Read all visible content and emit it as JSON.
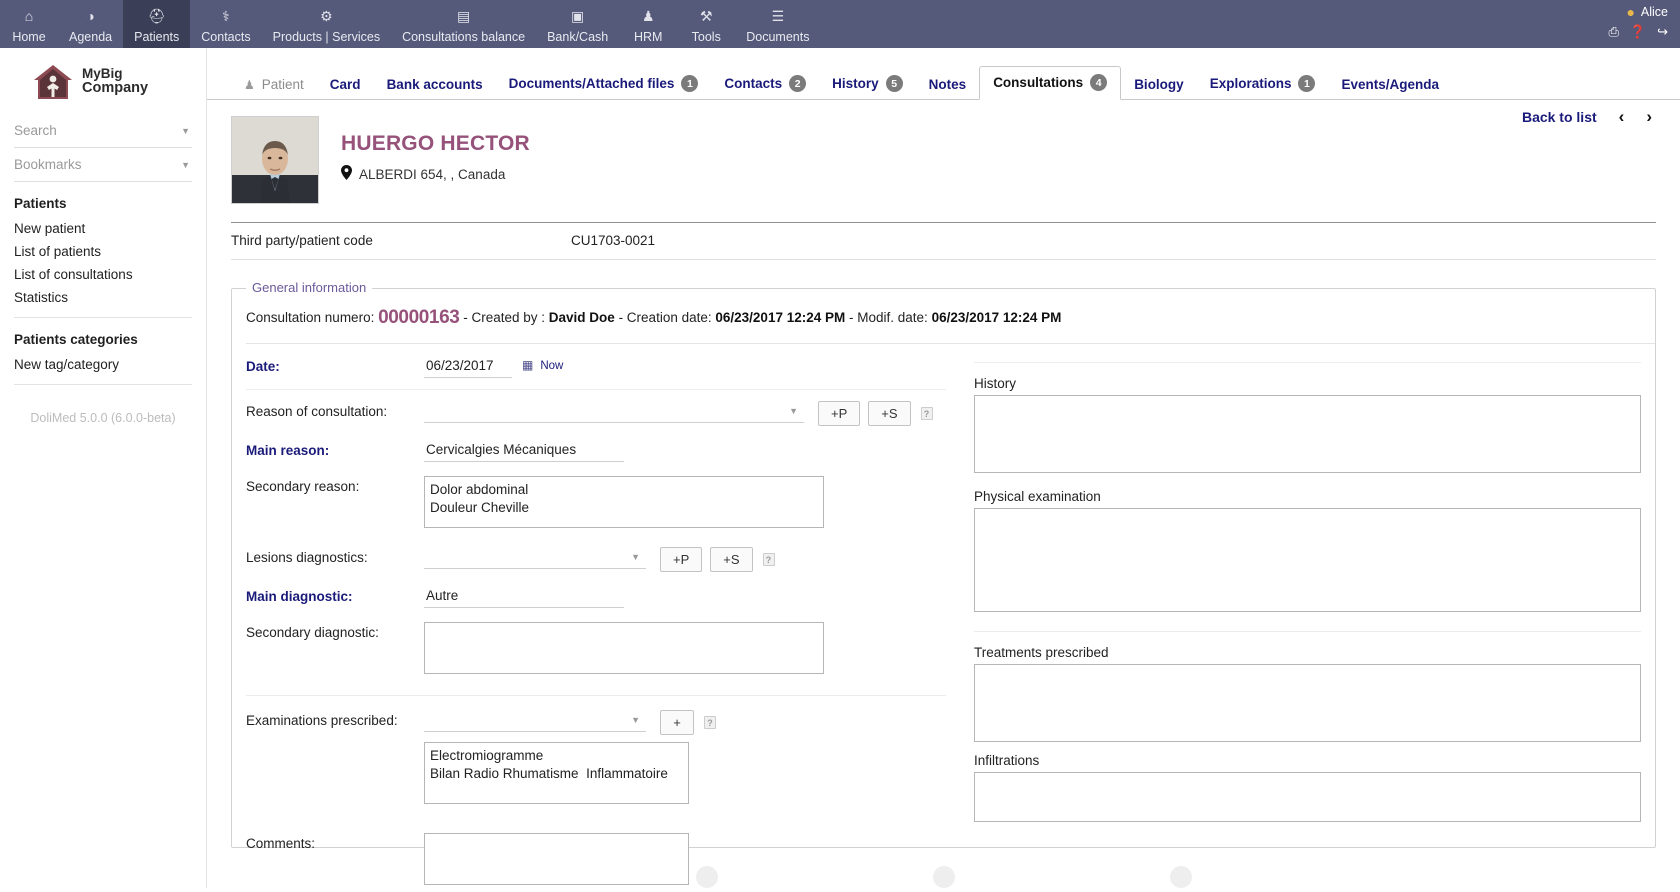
{
  "topnav": {
    "items": [
      {
        "label": "Home",
        "icon": "home-icon",
        "glyph": "⌂",
        "active": false
      },
      {
        "label": "Agenda",
        "icon": "agenda-icon",
        "glyph": "◑",
        "active": false
      },
      {
        "label": "Patients",
        "icon": "patients-icon",
        "glyph": "⛑",
        "active": true
      },
      {
        "label": "Contacts",
        "icon": "stethoscope-icon",
        "glyph": "⚕",
        "active": false
      },
      {
        "label": "Products | Services",
        "icon": "products-icon",
        "glyph": "⚙",
        "active": false
      },
      {
        "label": "Consultations balance",
        "icon": "balance-icon",
        "glyph": "▤",
        "active": false
      },
      {
        "label": "Bank/Cash",
        "icon": "bank-icon",
        "glyph": "▣",
        "active": false
      },
      {
        "label": "HRM",
        "icon": "hrm-icon",
        "glyph": "♟",
        "active": false
      },
      {
        "label": "Tools",
        "icon": "tools-icon",
        "glyph": "⚒",
        "active": false
      },
      {
        "label": "Documents",
        "icon": "documents-icon",
        "glyph": "☰",
        "active": false
      }
    ],
    "user": "Alice",
    "user_icon": "user-avatar-icon",
    "actions": [
      {
        "name": "print-icon",
        "glyph": "⎙"
      },
      {
        "name": "help-icon",
        "glyph": "❓"
      },
      {
        "name": "logout-icon",
        "glyph": "↪"
      }
    ]
  },
  "sidebar": {
    "logo_line1": "MyBig",
    "logo_line2": "Company",
    "logo_icon": "company-house-logo",
    "search_placeholder": "Search",
    "bookmarks_placeholder": "Bookmarks",
    "groups": [
      {
        "title": "Patients",
        "links": [
          "New patient",
          "List of patients",
          "List of consultations",
          "Statistics"
        ]
      },
      {
        "title": "Patients categories",
        "links": [
          "New tag/category"
        ]
      }
    ],
    "version": "DoliMed 5.0.0 (6.0.0-beta)"
  },
  "tabs": [
    {
      "label": "Patient",
      "badge": "",
      "icon": "patient-icon",
      "state": "plain"
    },
    {
      "label": "Card",
      "badge": "",
      "icon": "",
      "state": "normal"
    },
    {
      "label": "Bank accounts",
      "badge": "",
      "icon": "",
      "state": "normal"
    },
    {
      "label": "Documents/Attached files",
      "badge": "1",
      "icon": "",
      "state": "normal"
    },
    {
      "label": "Contacts",
      "badge": "2",
      "icon": "",
      "state": "normal"
    },
    {
      "label": "History",
      "badge": "5",
      "icon": "",
      "state": "normal"
    },
    {
      "label": "Notes",
      "badge": "",
      "icon": "",
      "state": "normal"
    },
    {
      "label": "Consultations",
      "badge": "4",
      "icon": "",
      "state": "active"
    },
    {
      "label": "Biology",
      "badge": "",
      "icon": "",
      "state": "normal"
    },
    {
      "label": "Explorations",
      "badge": "1",
      "icon": "",
      "state": "normal"
    },
    {
      "label": "Events/Agenda",
      "badge": "",
      "icon": "",
      "state": "normal"
    }
  ],
  "patient": {
    "name": "HUERGO HECTOR",
    "address": "ALBERDI 654, , Canada",
    "photo_alt": "patient-photo",
    "back_to_list": "Back to list",
    "prev_glyph": "‹",
    "next_glyph": "›"
  },
  "code_row": {
    "label": "Third party/patient code",
    "value": "CU1703-0021"
  },
  "general_information": {
    "legend": "General information",
    "meta_prefix": "Consultation numero:",
    "consultation_number": "00000163",
    "meta_created_by_label": "- Created by :",
    "created_by": "David Doe",
    "meta_creation_label": "- Creation date:",
    "creation_date": "06/23/2017 12:24 PM",
    "meta_modif_label": "- Modif. date:",
    "modif_date": "06/23/2017 12:24 PM",
    "date_label": "Date:",
    "date_value": "06/23/2017",
    "date_picker_icon": "calendar-icon",
    "now_link": "Now",
    "reason_label": "Reason of consultation:",
    "reason_value": "",
    "reason_btn_p": "+P",
    "reason_btn_s": "+S",
    "main_reason_label": "Main reason:",
    "main_reason_value": "Cervicalgies Mécaniques",
    "secondary_reason_label": "Secondary reason:",
    "secondary_reason_value": "Dolor abdominal\nDouleur Cheville",
    "lesions_label": "Lesions diagnostics:",
    "lesions_value": "",
    "lesions_btn_p": "+P",
    "lesions_btn_s": "+S",
    "main_diagnostic_label": "Main diagnostic:",
    "main_diagnostic_value": "Autre",
    "secondary_diagnostic_label": "Secondary diagnostic:",
    "secondary_diagnostic_value": "",
    "exams_label": "Examinations prescribed:",
    "exams_select_value": "",
    "exams_btn_add": "+",
    "exams_value": "Electromiogramme\nBilan Radio Rhumatisme  Inflammatoire",
    "comments_label": "Comments:",
    "comments_value": "",
    "history_label": "History",
    "history_value": "",
    "physical_exam_label": "Physical examination",
    "physical_exam_value": "",
    "treatments_label": "Treatments prescribed",
    "treatments_value": "",
    "infiltrations_label": "Infiltrations",
    "infiltrations_value": "",
    "help_glyph": "?"
  },
  "colors": {
    "nav_bg": "#55597a",
    "nav_active": "#3a3e57",
    "link": "#1a1a7a",
    "patient_name": "#96527a",
    "legend": "#6a5a9a",
    "badge": "#7b7b7b"
  }
}
